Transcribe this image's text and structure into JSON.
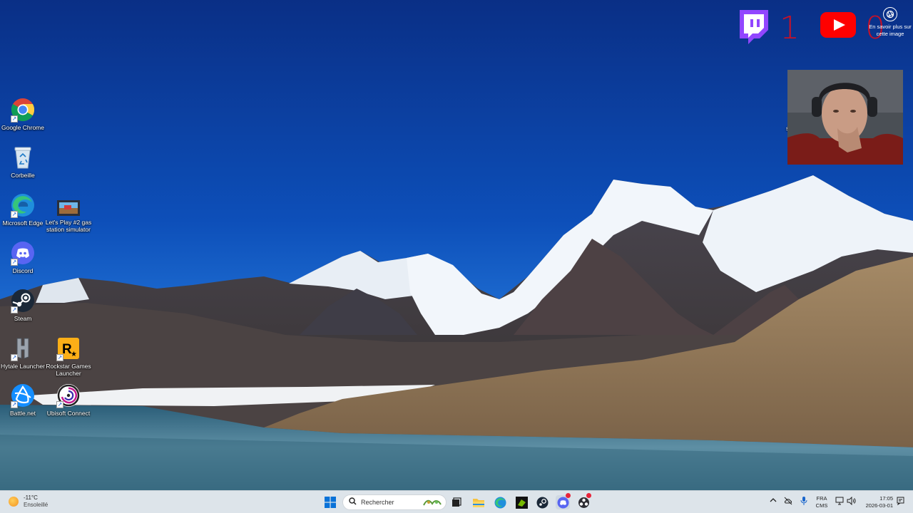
{
  "desktop": {
    "icons": [
      {
        "label": "Google Chrome",
        "icon": "chrome-icon"
      },
      {
        "label": "Corbeille",
        "icon": "recycle-bin-icon"
      },
      {
        "label": "Microsoft Edge",
        "icon": "edge-icon"
      },
      {
        "label": "Let's Play #2 gas station simulator",
        "icon": "video-file-icon"
      },
      {
        "label": "Discord",
        "icon": "discord-icon"
      },
      {
        "label": "Steam",
        "icon": "steam-icon"
      },
      {
        "label": "Hytale Launcher",
        "icon": "hytale-icon"
      },
      {
        "label": "Rockstar Games Launcher",
        "icon": "rockstar-icon"
      },
      {
        "label": "Battle.net",
        "icon": "battlenet-icon"
      },
      {
        "label": "Ubisoft Connect",
        "icon": "ubisoft-icon"
      },
      {
        "label": "schedule",
        "icon": "schedule-image-icon"
      }
    ]
  },
  "overlay": {
    "twitch_count": "1",
    "youtube_count": "0",
    "learn_more": "En savoir plus sur cette image",
    "brand_colors": {
      "twitch": "#9146ff",
      "youtube": "#ff0000",
      "counter": "#c3122a"
    }
  },
  "taskbar": {
    "weather": {
      "temp": "-11°C",
      "condition": "Ensoleillé"
    },
    "search_placeholder": "Rechercher",
    "pinned": [
      "start-icon",
      "task-view-icon",
      "file-explorer-icon",
      "edge-icon",
      "nvidia-icon",
      "steam-icon",
      "discord-icon",
      "obs-icon"
    ],
    "tray": {
      "language_1": "FRA",
      "language_2": "CMS",
      "time": "17:05",
      "date": "2026-03-01"
    }
  }
}
